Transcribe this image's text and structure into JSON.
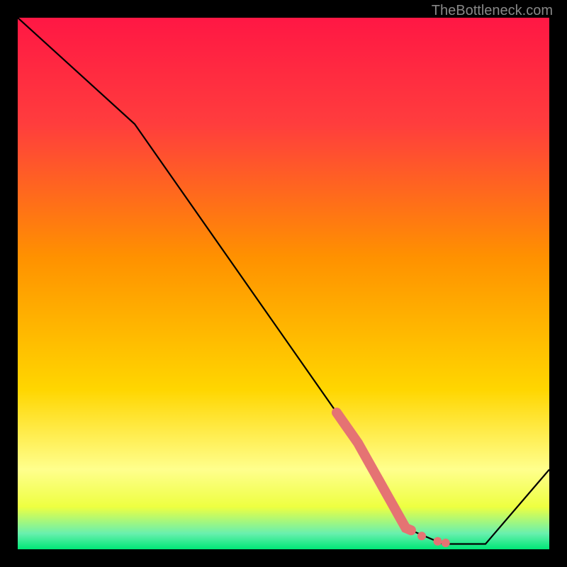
{
  "attribution": "TheBottleneck.com",
  "colors": {
    "top": "#ff1744",
    "upper_mid": "#ff6d00",
    "mid": "#ffd600",
    "lower_mid": "#ffff8d",
    "bottom": "#00e676",
    "line": "#000000",
    "marker": "#e57373",
    "frame": "#000000"
  },
  "chart_data": {
    "type": "line",
    "title": "",
    "xlabel": "",
    "ylabel": "",
    "xlim": [
      0,
      100
    ],
    "ylim": [
      0,
      100
    ],
    "line": [
      {
        "x": 0,
        "y": 100
      },
      {
        "x": 22,
        "y": 80
      },
      {
        "x": 64,
        "y": 20
      },
      {
        "x": 73,
        "y": 4
      },
      {
        "x": 80,
        "y": 1
      },
      {
        "x": 88,
        "y": 1
      },
      {
        "x": 100,
        "y": 15
      }
    ],
    "highlight_segment": {
      "x_start": 60,
      "x_end": 74
    },
    "markers": [
      {
        "x": 74,
        "y": 3.5
      },
      {
        "x": 76,
        "y": 2.5
      },
      {
        "x": 79,
        "y": 1.5
      },
      {
        "x": 80.5,
        "y": 1.2
      }
    ],
    "gradient_bands": [
      {
        "stop": 0.0,
        "color": "#ff1744"
      },
      {
        "stop": 0.2,
        "color": "#ff3d3d"
      },
      {
        "stop": 0.45,
        "color": "#ff9100"
      },
      {
        "stop": 0.7,
        "color": "#ffd600"
      },
      {
        "stop": 0.85,
        "color": "#ffff8d"
      },
      {
        "stop": 0.92,
        "color": "#eeff41"
      },
      {
        "stop": 0.97,
        "color": "#69f0ae"
      },
      {
        "stop": 1.0,
        "color": "#00e676"
      }
    ]
  }
}
